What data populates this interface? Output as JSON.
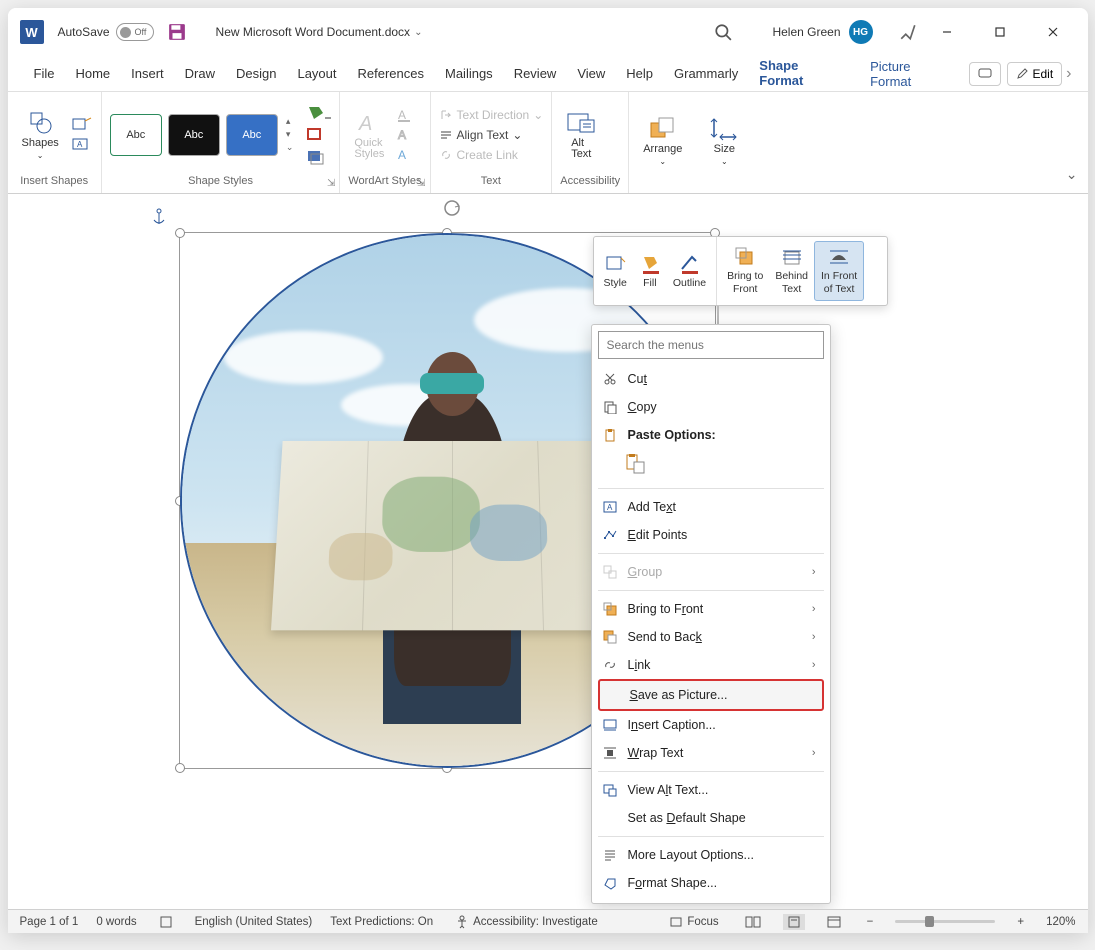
{
  "titlebar": {
    "app_icon_text": "W",
    "autosave_label": "AutoSave",
    "autosave_state": "Off",
    "document_title": "New Microsoft Word Document.docx",
    "user_name": "Helen Green",
    "user_initials": "HG"
  },
  "menubar": {
    "tabs": [
      "File",
      "Home",
      "Insert",
      "Draw",
      "Design",
      "Layout",
      "References",
      "Mailings",
      "Review",
      "View",
      "Help",
      "Grammarly",
      "Shape Format",
      "Picture Format"
    ],
    "active_tab_index": 12,
    "edit_label": "Edit"
  },
  "ribbon": {
    "groups": {
      "insert_shapes": {
        "label": "Insert Shapes",
        "shapes_btn": "Shapes"
      },
      "shape_styles": {
        "label": "Shape Styles",
        "preset_text": "Abc"
      },
      "wordart_styles": {
        "label": "WordArt Styles",
        "quick_styles": "Quick\nStyles"
      },
      "text": {
        "label": "Text",
        "text_direction": "Text Direction",
        "align_text": "Align Text",
        "create_link": "Create Link"
      },
      "accessibility": {
        "label": "Accessibility",
        "alt_text": "Alt\nText"
      },
      "arrange": {
        "label": "Arrange"
      },
      "size": {
        "label": "Size"
      }
    }
  },
  "mini_toolbar": {
    "style": "Style",
    "fill": "Fill",
    "outline": "Outline",
    "bring_to_front": "Bring to\nFront",
    "behind_text": "Behind\nText",
    "in_front_of_text": "In Front\nof Text"
  },
  "context_menu": {
    "search_placeholder": "Search the menus",
    "items": {
      "cut": "Cut",
      "copy": "Copy",
      "paste_options": "Paste Options:",
      "add_text": "Add Text",
      "edit_points": "Edit Points",
      "group": "Group",
      "bring_to_front": "Bring to Front",
      "send_to_back": "Send to Back",
      "link": "Link",
      "save_as_picture": "Save as Picture...",
      "insert_caption": "Insert Caption...",
      "wrap_text": "Wrap Text",
      "view_alt_text": "View Alt Text...",
      "set_as_default_shape": "Set as Default Shape",
      "more_layout_options": "More Layout Options...",
      "format_shape": "Format Shape..."
    }
  },
  "statusbar": {
    "page": "Page 1 of 1",
    "words": "0 words",
    "language": "English (United States)",
    "text_predictions": "Text Predictions: On",
    "accessibility": "Accessibility: Investigate",
    "focus": "Focus",
    "zoom": "120%"
  }
}
